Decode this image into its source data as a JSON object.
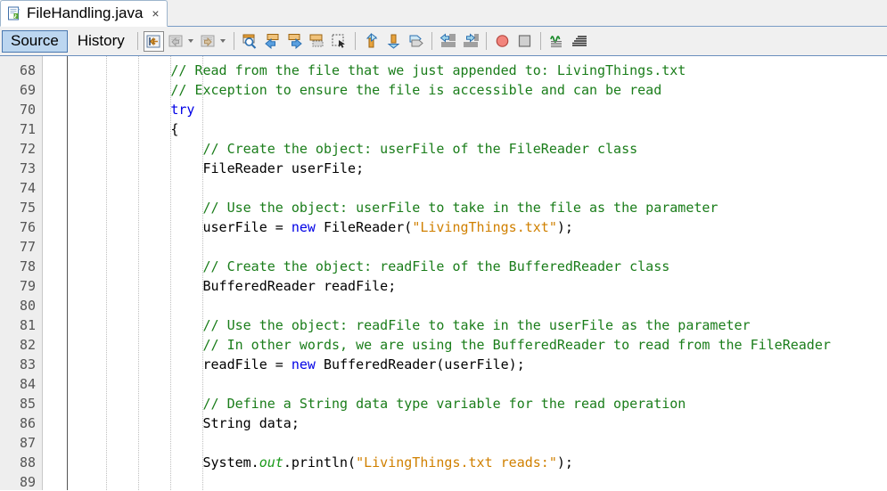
{
  "window": {
    "document_tab": {
      "title": "FileHandling.java",
      "close_label": "×",
      "icon": "java-file-icon"
    }
  },
  "view_tabs": [
    {
      "label": "Source",
      "selected": true
    },
    {
      "label": "History",
      "selected": false
    }
  ],
  "toolbar": {
    "groups": [
      {
        "name": "navigation-group",
        "buttons": [
          {
            "name": "last-edit-position-button",
            "icon": "last-edit-icon",
            "framed": true,
            "dropdown": false
          },
          {
            "name": "back-button",
            "icon": "back-arrow-icon",
            "framed": false,
            "dropdown": true
          },
          {
            "name": "forward-button",
            "icon": "forward-arrow-icon",
            "framed": false,
            "dropdown": true
          }
        ]
      },
      {
        "name": "find-group",
        "buttons": [
          {
            "name": "find-selection-button",
            "icon": "find-magnifier-icon",
            "framed": false,
            "dropdown": false
          },
          {
            "name": "find-previous-button",
            "icon": "find-previous-icon",
            "framed": false,
            "dropdown": false
          },
          {
            "name": "find-next-button",
            "icon": "find-next-icon",
            "framed": false,
            "dropdown": false
          },
          {
            "name": "toggle-highlight-button",
            "icon": "toggle-highlight-icon",
            "framed": false,
            "dropdown": false
          },
          {
            "name": "rectangular-selection-button",
            "icon": "rectangular-selection-icon",
            "framed": false,
            "dropdown": false
          }
        ]
      },
      {
        "name": "move-group",
        "buttons": [
          {
            "name": "shift-line-up-button",
            "icon": "shift-up-icon",
            "framed": false,
            "dropdown": false
          },
          {
            "name": "shift-line-down-button",
            "icon": "shift-down-icon",
            "framed": false,
            "dropdown": false
          },
          {
            "name": "copy-line-button",
            "icon": "copy-line-icon",
            "framed": false,
            "dropdown": false
          }
        ]
      },
      {
        "name": "indent-group",
        "buttons": [
          {
            "name": "shift-left-button",
            "icon": "shift-left-icon",
            "framed": false,
            "dropdown": false
          },
          {
            "name": "shift-right-button",
            "icon": "shift-right-icon",
            "framed": false,
            "dropdown": false
          }
        ]
      },
      {
        "name": "debug-group",
        "buttons": [
          {
            "name": "toggle-breakpoint-button",
            "icon": "breakpoint-circle-icon",
            "framed": false,
            "dropdown": false
          },
          {
            "name": "stop-button",
            "icon": "stop-square-icon",
            "framed": false,
            "dropdown": false
          }
        ]
      },
      {
        "name": "format-group",
        "buttons": [
          {
            "name": "inspect-button",
            "icon": "inspect-lines-icon",
            "framed": false,
            "dropdown": false
          },
          {
            "name": "format-button",
            "icon": "format-lines-icon",
            "framed": false,
            "dropdown": false
          }
        ]
      }
    ]
  },
  "editor": {
    "first_line_number": 68,
    "colors": {
      "comment": "#1a7d1a",
      "keyword": "#0000e6",
      "string": "#d08000",
      "static_field": "#1a9a1a",
      "plain": "#000000",
      "gutter_background": "#eeeeee",
      "background": "#ffffff"
    },
    "lines": [
      {
        "number": 68,
        "tokens": [
          {
            "t": "comment",
            "s": "            // Read from the file that we just appended to: LivingThings.txt"
          }
        ]
      },
      {
        "number": 69,
        "tokens": [
          {
            "t": "comment",
            "s": "            // Exception to ensure the file is accessible and can be read"
          }
        ]
      },
      {
        "number": 70,
        "tokens": [
          {
            "t": "keyword",
            "s": "            try"
          }
        ]
      },
      {
        "number": 71,
        "tokens": [
          {
            "t": "plain",
            "s": "            {"
          }
        ]
      },
      {
        "number": 72,
        "tokens": [
          {
            "t": "comment",
            "s": "                // Create the object: userFile of the FileReader class"
          }
        ]
      },
      {
        "number": 73,
        "tokens": [
          {
            "t": "plain",
            "s": "                FileReader userFile;"
          }
        ]
      },
      {
        "number": 74,
        "tokens": [
          {
            "t": "plain",
            "s": ""
          }
        ]
      },
      {
        "number": 75,
        "tokens": [
          {
            "t": "comment",
            "s": "                // Use the object: userFile to take in the file as the parameter"
          }
        ]
      },
      {
        "number": 76,
        "tokens": [
          {
            "t": "plain",
            "s": "                userFile = "
          },
          {
            "t": "keyword",
            "s": "new"
          },
          {
            "t": "plain",
            "s": " FileReader("
          },
          {
            "t": "string",
            "s": "\"LivingThings.txt\""
          },
          {
            "t": "plain",
            "s": ");"
          }
        ]
      },
      {
        "number": 77,
        "tokens": [
          {
            "t": "plain",
            "s": ""
          }
        ]
      },
      {
        "number": 78,
        "tokens": [
          {
            "t": "comment",
            "s": "                // Create the object: readFile of the BufferedReader class"
          }
        ]
      },
      {
        "number": 79,
        "tokens": [
          {
            "t": "plain",
            "s": "                BufferedReader readFile;"
          }
        ]
      },
      {
        "number": 80,
        "tokens": [
          {
            "t": "plain",
            "s": ""
          }
        ]
      },
      {
        "number": 81,
        "tokens": [
          {
            "t": "comment",
            "s": "                // Use the object: readFile to take in the userFile as the parameter"
          }
        ]
      },
      {
        "number": 82,
        "tokens": [
          {
            "t": "comment",
            "s": "                // In other words, we are using the BufferedReader to read from the FileReader"
          }
        ]
      },
      {
        "number": 83,
        "tokens": [
          {
            "t": "plain",
            "s": "                readFile = "
          },
          {
            "t": "keyword",
            "s": "new"
          },
          {
            "t": "plain",
            "s": " BufferedReader(userFile);"
          }
        ]
      },
      {
        "number": 84,
        "tokens": [
          {
            "t": "plain",
            "s": ""
          }
        ]
      },
      {
        "number": 85,
        "tokens": [
          {
            "t": "comment",
            "s": "                // Define a String data type variable for the read operation"
          }
        ]
      },
      {
        "number": 86,
        "tokens": [
          {
            "t": "plain",
            "s": "                String data;"
          }
        ]
      },
      {
        "number": 87,
        "tokens": [
          {
            "t": "plain",
            "s": ""
          }
        ]
      },
      {
        "number": 88,
        "tokens": [
          {
            "t": "plain",
            "s": "                System."
          },
          {
            "t": "static",
            "s": "out"
          },
          {
            "t": "plain",
            "s": ".println("
          },
          {
            "t": "string",
            "s": "\"LivingThings.txt reads:\""
          },
          {
            "t": "plain",
            "s": ");"
          }
        ]
      },
      {
        "number": 89,
        "tokens": [
          {
            "t": "plain",
            "s": ""
          }
        ]
      }
    ]
  }
}
